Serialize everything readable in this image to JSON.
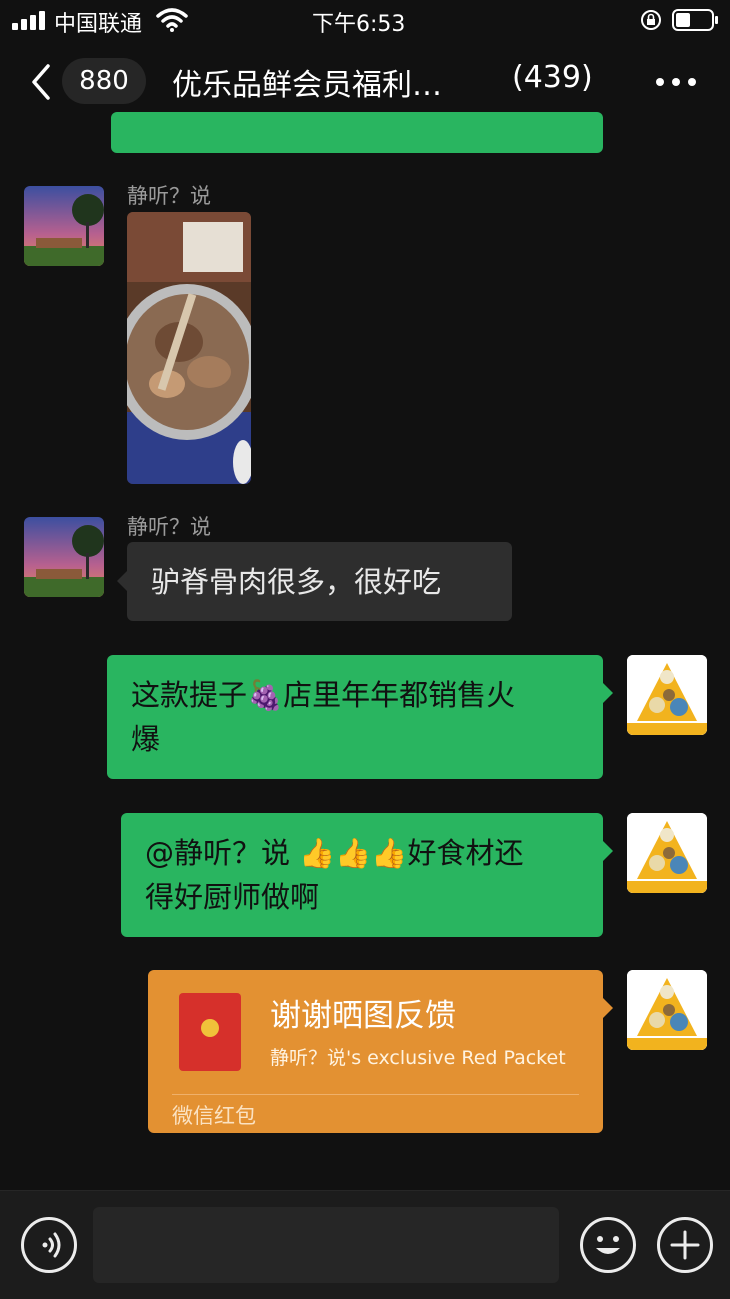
{
  "status_bar": {
    "carrier": "中国联通",
    "time": "下午6:53",
    "signal_icon": "signal-bars-icon",
    "wifi_icon": "wifi-icon",
    "lock_icon": "orientation-lock-icon",
    "battery_icon": "battery-icon"
  },
  "header": {
    "back_icon": "chevron-left-icon",
    "unread_count": "880",
    "title": "优乐品鲜会员福利…",
    "member_count": "(439)",
    "more_icon": "more-dots-icon"
  },
  "messages": [
    {
      "type": "image",
      "sender": "静听？说",
      "side": "left"
    },
    {
      "type": "text",
      "sender": "静听？说",
      "side": "left",
      "text": "驴脊骨肉很多，很好吃"
    },
    {
      "type": "text",
      "side": "right",
      "line1": "这款提子🍇店里年年都销售火",
      "line2": "爆"
    },
    {
      "type": "text",
      "side": "right",
      "line1": "@静听？说 👍👍👍好食材还",
      "line2": "得好厨师做啊"
    },
    {
      "type": "red_packet",
      "side": "right",
      "title": "谢谢晒图反馈",
      "subtitle": "静听？说's exclusive Red Packet",
      "footer": "微信红包"
    }
  ],
  "input_bar": {
    "voice_icon": "voice-input-icon",
    "emoji_icon": "emoji-icon",
    "add_icon": "add-plus-icon"
  },
  "colors": {
    "background": "#111111",
    "bubble_green": "#29b560",
    "bubble_dark": "#2e2e2e",
    "red_packet": "#e39132"
  }
}
